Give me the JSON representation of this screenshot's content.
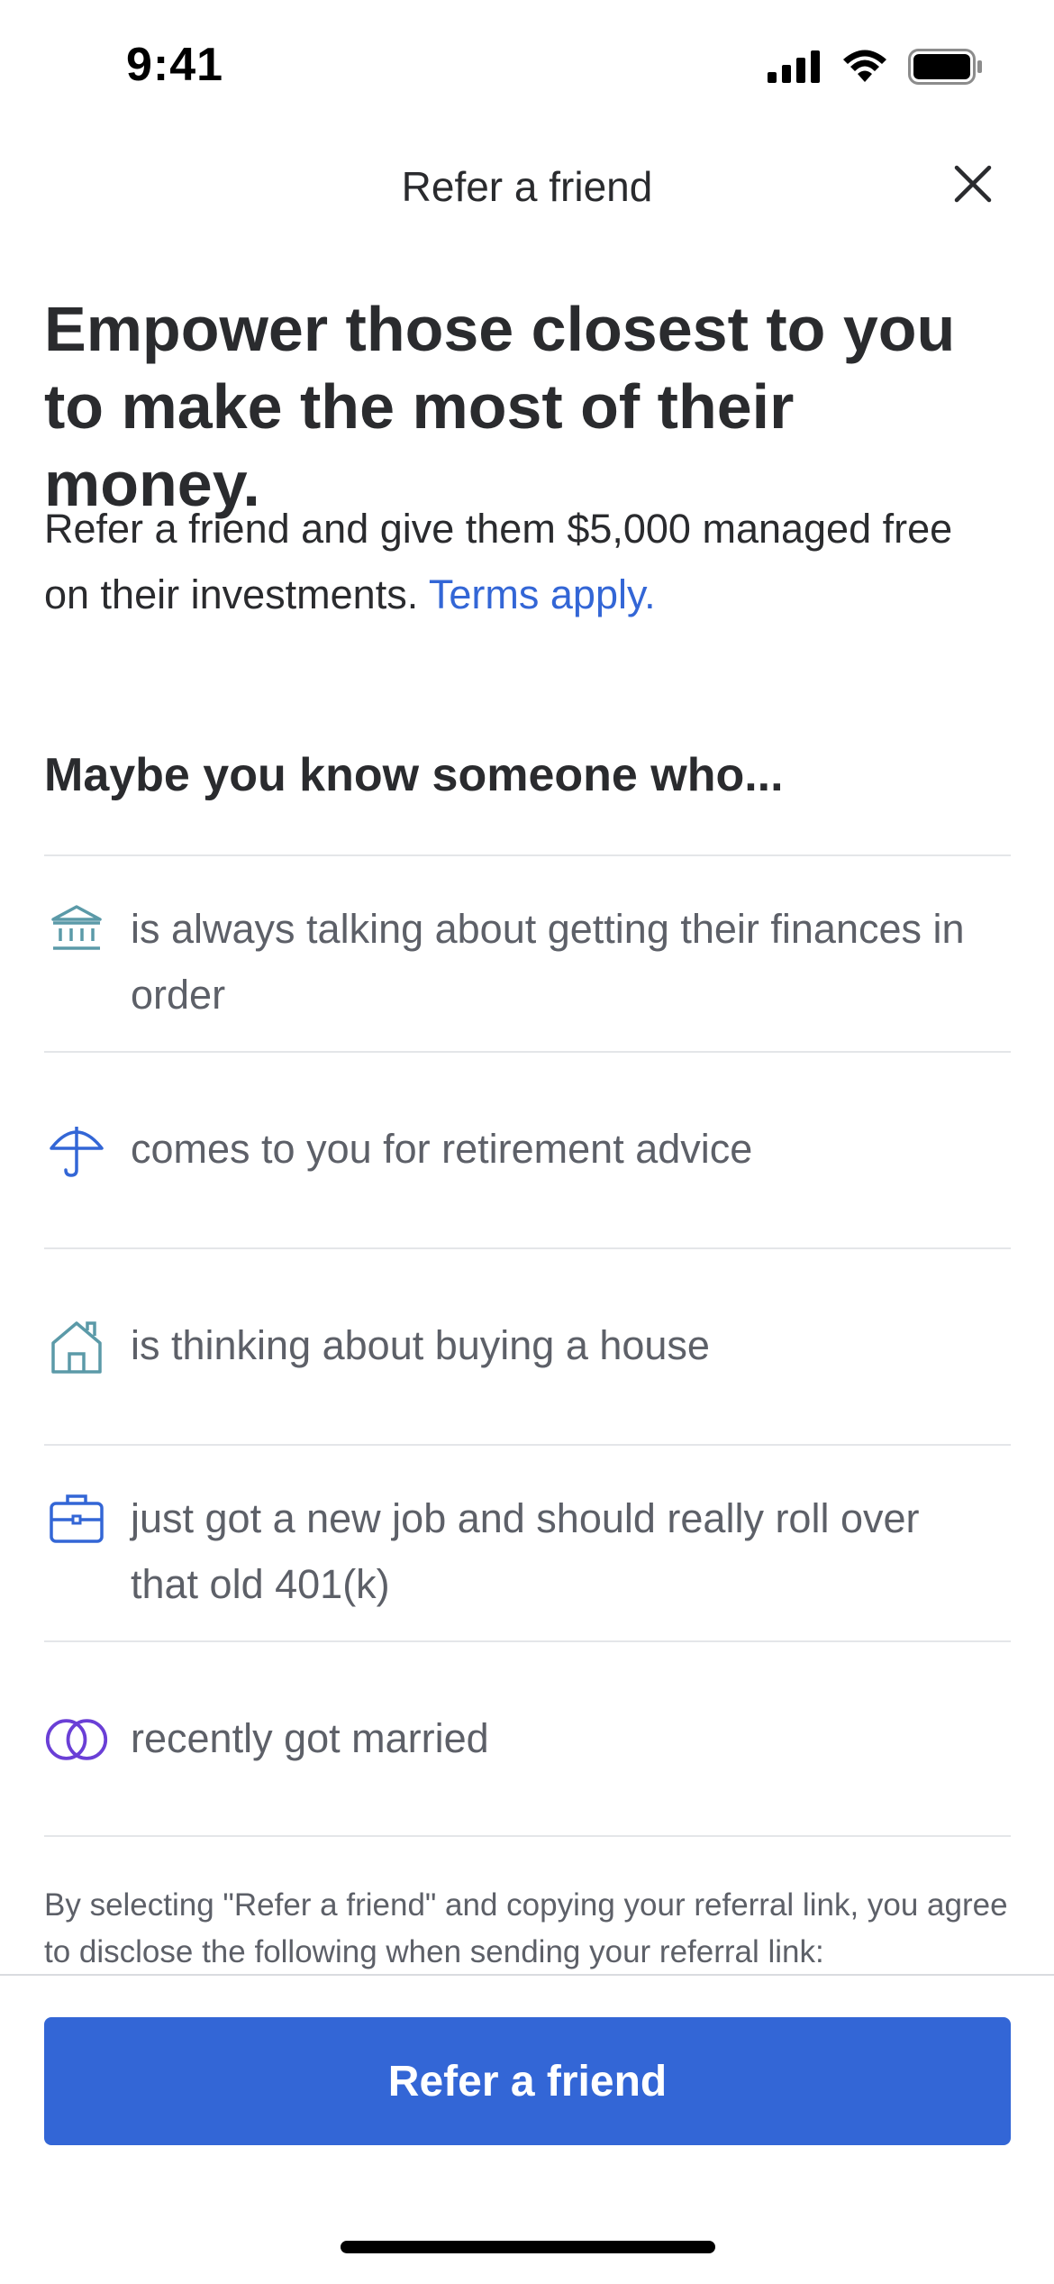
{
  "status_bar": {
    "time": "9:41",
    "icons": [
      "cellular-signal-icon",
      "wifi-icon",
      "battery-icon"
    ]
  },
  "header": {
    "title": "Refer a friend",
    "close_icon": "close-icon"
  },
  "hero": {
    "title": "Empower those closest to you to make the most of their money.",
    "body": "Refer a friend and give them $5,000 managed free on their investments.",
    "terms_link": "Terms apply."
  },
  "section": {
    "title": "Maybe you know someone who..."
  },
  "reasons": [
    {
      "icon": "bank-icon",
      "text": "is always talking about getting their finances in order"
    },
    {
      "icon": "umbrella-icon",
      "text": "comes to you for retirement advice"
    },
    {
      "icon": "house-icon",
      "text": "is thinking about buying a house"
    },
    {
      "icon": "briefcase-icon",
      "text": "just got a new job and should really roll over that old 401(k)"
    },
    {
      "icon": "rings-icon",
      "text": "recently got married"
    }
  ],
  "disclosure": "By selecting \"Refer a friend\" and copying your referral link, you agree to disclose the following when sending your referral link:",
  "cta": {
    "label": "Refer a friend"
  },
  "colors": {
    "accent": "#3366d6",
    "icon_teal": "#5b9aa8",
    "icon_purple": "#6a3fd6",
    "text_primary": "#2a2b2e",
    "text_secondary": "#5d6068"
  }
}
